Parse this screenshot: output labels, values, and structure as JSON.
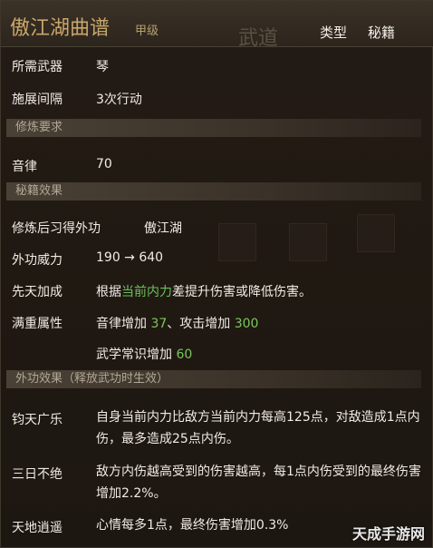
{
  "header": {
    "title": "傲江湖曲谱",
    "grade": "甲级",
    "type_label": "类型",
    "type_value": "秘籍",
    "ghost_tab": "武道"
  },
  "rows": {
    "weapon": {
      "label": "所需武器",
      "value": "琴"
    },
    "interval": {
      "label": "施展间隔",
      "value": "3次行动"
    }
  },
  "sections": {
    "requirements": "修炼要求",
    "effects": "秘籍效果",
    "external": "外功效果（释放武功时生效）"
  },
  "requirement": {
    "label": "音律",
    "value": "70"
  },
  "effects": {
    "skill": {
      "label": "修炼后习得外功",
      "value": "傲江湖"
    },
    "power": {
      "label": "外功威力",
      "value": "190 → 640"
    },
    "innate": {
      "label": "先天加成",
      "prefix": "根据",
      "highlight": "当前内力",
      "suffix": "差提升伤害或降低伤害。"
    },
    "full": {
      "label": "满重属性",
      "line1_a": "音律增加",
      "line1_b": "37",
      "line1_c": "、攻击增加",
      "line1_d": "300",
      "line2_a": "武学常识增加",
      "line2_b": "60"
    }
  },
  "external": {
    "e1": {
      "label": "钧天广乐",
      "text": "自身当前内力比敌方当前内力每高125点，对敌造成1点内伤，最多造成25点内伤。"
    },
    "e2": {
      "label": "三日不绝",
      "text": "敌方内伤越高受到的伤害越高，每1点内伤受到的最终伤害增加2.2%。"
    },
    "e3": {
      "label": "天地逍遥",
      "text": "心情每多1点，最终伤害增加0.3%"
    }
  },
  "watermark": "天成手游网"
}
